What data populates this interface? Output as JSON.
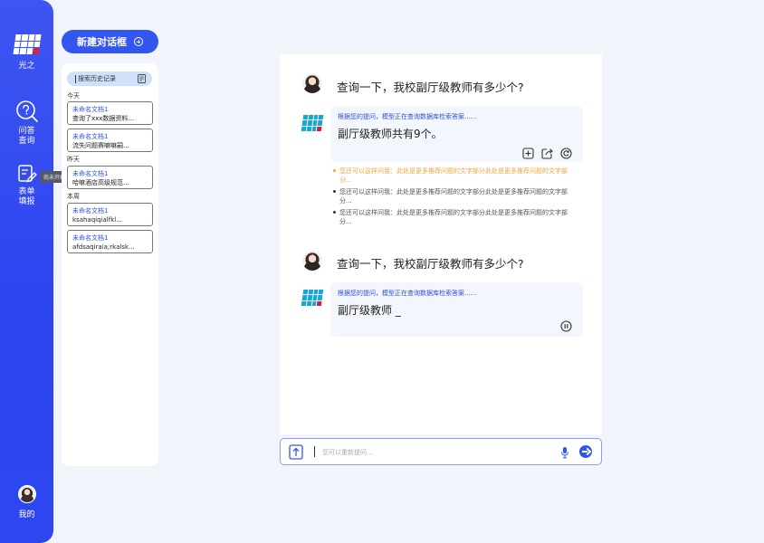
{
  "app": {
    "brand_label": "光之"
  },
  "nav": {
    "qa_label_line1": "问答",
    "qa_label_line2": "查询",
    "form_label_line1": "表单",
    "form_label_line2": "填报",
    "form_tooltip": "尚未开始",
    "me_label": "我的"
  },
  "new_chat": {
    "label": "新建对话框"
  },
  "history": {
    "search_placeholder": "搜索历史记录",
    "groups": [
      {
        "label": "今天",
        "items": [
          {
            "title": "未命名文档1",
            "snippet": "查询了xxx数据资料..."
          },
          {
            "title": "未命名文档1",
            "snippet": "流失问题赛嘛嘛嗣..."
          }
        ]
      },
      {
        "label": "昨天",
        "items": [
          {
            "title": "未命名文档1",
            "snippet": "哈嘛酒店高级规范..."
          }
        ]
      },
      {
        "label": "本周",
        "items": [
          {
            "title": "未命名文档1",
            "snippet": "ksahaqiqialfkl..."
          },
          {
            "title": "未命名文档1",
            "snippet": "afdsaqiraia;rkalsk..."
          }
        ]
      }
    ]
  },
  "chat": {
    "messages": [
      {
        "question": "查询一下，我校副厅级教师有多少个?",
        "hint": "根据您的提问，模型正在查询数据库检索答案......",
        "answer": "副厅级教师共有9个。",
        "suggestions": [
          {
            "text": "您还可以这样问我：此处是更多推荐问题的文字部分此处是更多推荐问题的文字部分..."
          },
          {
            "text": "您还可以这样问我：此处是更多推荐问题的文字部分此处是更多推荐问题的文字部分..."
          },
          {
            "text": "您还可以这样问我：此处是更多推荐问题的文字部分此处是更多推荐问题的文字部分..."
          }
        ]
      },
      {
        "question": "查询一下，我校副厅级教师有多少个?",
        "hint": "根据您的提问，模型正在查询数据库检索答案......",
        "answer": "副厅级教师 _"
      }
    ]
  },
  "input": {
    "placeholder": "您可以重新提问..."
  },
  "colors": {
    "accent": "#3356f1",
    "highlight": "#f0a541",
    "logo_blue": "#14a7d8",
    "logo_red": "#d81b3b"
  }
}
